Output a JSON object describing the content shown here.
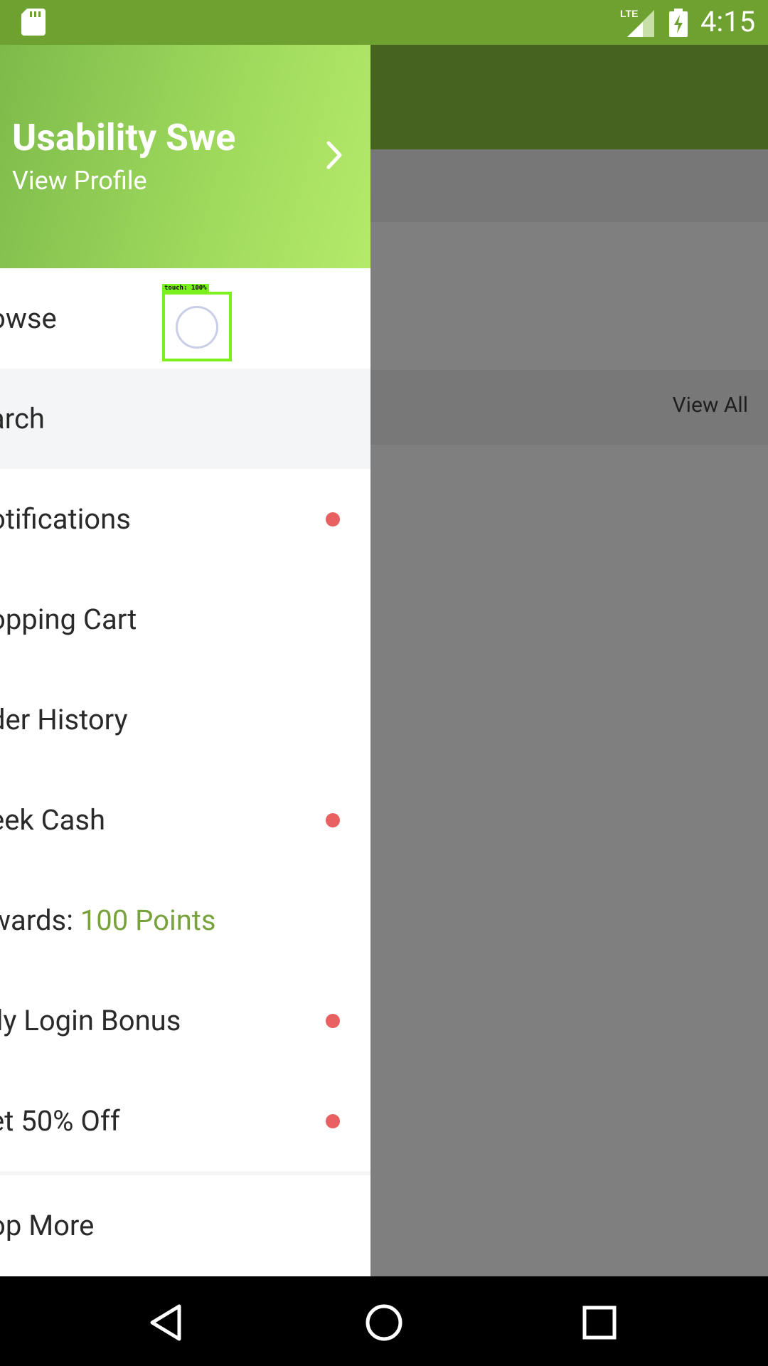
{
  "status_bar": {
    "time": "4:15",
    "network": "LTE",
    "icons": [
      "sd-card-icon",
      "lte-signal-icon",
      "battery-charging-icon"
    ]
  },
  "drawer": {
    "header": {
      "user_name": "Usability Swe",
      "view_profile": "View Profile"
    },
    "items": [
      {
        "label": "owse",
        "has_dot": false
      },
      {
        "label": "arch",
        "has_dot": false,
        "active": true
      },
      {
        "label": "otifications",
        "has_dot": true
      },
      {
        "label": "opping Cart",
        "has_dot": false
      },
      {
        "label": "der History",
        "has_dot": false
      },
      {
        "label": "eek Cash",
        "has_dot": true
      },
      {
        "label": "wards: ",
        "points": "100 Points",
        "has_dot": false
      },
      {
        "label": "ily Login Bonus",
        "has_dot": true
      },
      {
        "label": "et 50% Off",
        "has_dot": true
      },
      {
        "label": "op More",
        "has_dot": false
      }
    ]
  },
  "background": {
    "view_all": "View All"
  },
  "touch_indicator": {
    "label": "touch: 100%"
  },
  "colors": {
    "status_bar": "#6fa130",
    "accent_green": "#78a33c",
    "notification_dot": "#e86060",
    "toolbar_dimmed": "#46631f"
  }
}
